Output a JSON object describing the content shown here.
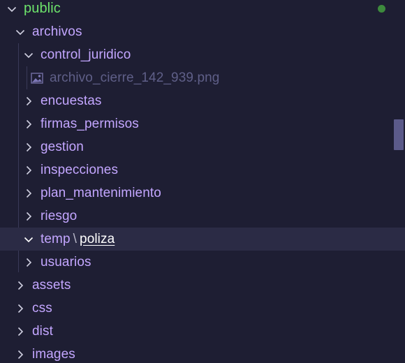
{
  "tree": {
    "root": {
      "label": "public",
      "expanded": true,
      "status": "green-dot"
    },
    "archivos": {
      "label": "archivos",
      "expanded": true
    },
    "control_juridico": {
      "label": "control_juridico",
      "expanded": true
    },
    "file": {
      "label": "archivo_cierre_142_939.png",
      "icon": "image-file-icon"
    },
    "encuestas": {
      "label": "encuestas"
    },
    "firmas_permisos": {
      "label": "firmas_permisos"
    },
    "gestion": {
      "label": "gestion"
    },
    "inspecciones": {
      "label": "inspecciones"
    },
    "plan_mantenimiento": {
      "label": "plan_mantenimiento"
    },
    "riesgo": {
      "label": "riesgo"
    },
    "temp_poliza": {
      "first": "temp",
      "separator": "\\",
      "second": "poliza",
      "expanded": true,
      "selected": true
    },
    "usuarios": {
      "label": "usuarios"
    },
    "assets": {
      "label": "assets"
    },
    "css": {
      "label": "css"
    },
    "dist": {
      "label": "dist"
    },
    "images": {
      "label": "images"
    }
  },
  "colors": {
    "background": "#1e1e33",
    "folder_text": "#c3a6ff",
    "root_text": "#6de36b",
    "file_text": "#5f5f88",
    "selected_row": "#2b2b45",
    "status_dot": "#3d8a3d",
    "scrollbar_thumb": "#5b5a8a"
  }
}
